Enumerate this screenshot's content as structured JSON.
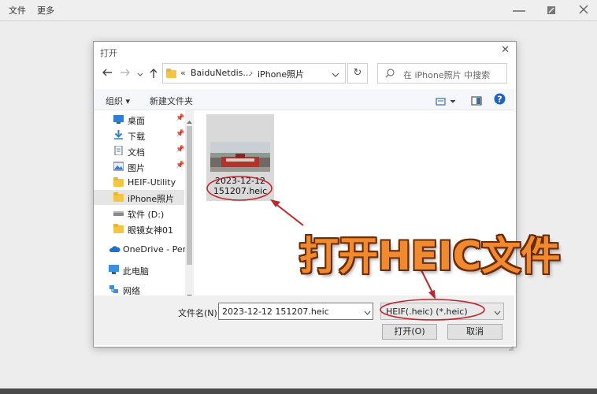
{
  "app": {
    "menu": [
      "文件",
      "更多"
    ]
  },
  "dialog": {
    "title": "打开",
    "address": {
      "prefix": "«",
      "segments": [
        "BaiduNetdis...",
        "iPhone照片"
      ]
    },
    "search_placeholder": "在 iPhone照片 中搜索",
    "toolbar": {
      "organize": "组织 ▾",
      "new_folder": "新建文件夹"
    },
    "nav_items": [
      {
        "label": "桌面",
        "icon": "desktop-icon",
        "pinned": true
      },
      {
        "label": "下载",
        "icon": "download-icon",
        "pinned": true
      },
      {
        "label": "文档",
        "icon": "document-icon",
        "pinned": true
      },
      {
        "label": "图片",
        "icon": "picture-icon",
        "pinned": true
      },
      {
        "label": "HEIF-Utility",
        "icon": "folder-icon",
        "pinned": false
      },
      {
        "label": "iPhone照片",
        "icon": "folder-icon",
        "pinned": false,
        "selected": true
      },
      {
        "label": "软件 (D:)",
        "icon": "drive-icon",
        "pinned": false
      },
      {
        "label": "眼镜女神01",
        "icon": "folder-icon",
        "pinned": false
      },
      {
        "label": "OneDrive - Perso",
        "icon": "cloud-icon",
        "pinned": false
      },
      {
        "label": "此电脑",
        "icon": "computer-icon",
        "pinned": false
      },
      {
        "label": "网络",
        "icon": "network-icon",
        "pinned": false
      }
    ],
    "file": {
      "name_line1": "2023-12-12",
      "name_line2": "151207.heic"
    },
    "footer": {
      "filename_label": "文件名(N):",
      "filename_value": "2023-12-12 151207.heic",
      "filetype_value": "HEIF(.heic) (*.heic)",
      "open_button": "打开(O)",
      "cancel_button": "取消"
    }
  },
  "annotation": {
    "headline": "打开HEIC文件",
    "color": "#f08a2c",
    "circle_color": "#c0272d"
  }
}
